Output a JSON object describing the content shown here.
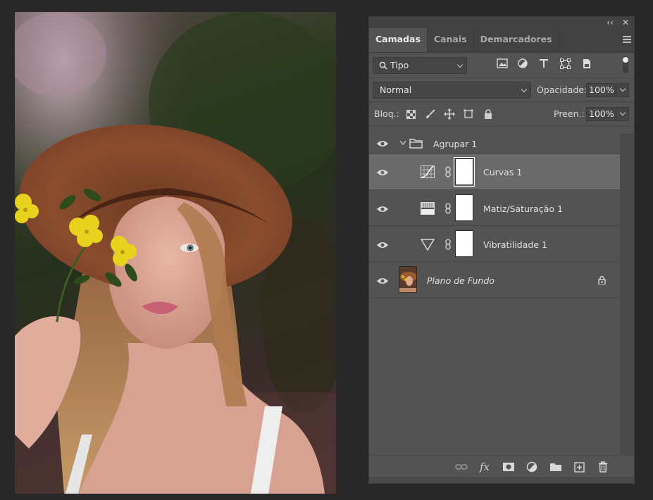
{
  "panel": {
    "collapse_glyph": "‹‹",
    "close_glyph": "✕",
    "tabs": [
      {
        "label": "Camadas"
      },
      {
        "label": "Canais"
      },
      {
        "label": "Demarcadores"
      }
    ],
    "filter": {
      "label": "Tipo",
      "icon": "search-icon"
    },
    "blend_mode": "Normal",
    "opacity_label": "Opacidade:",
    "opacity_value": "100%",
    "lock_label": "Bloq.:",
    "fill_label": "Preen.:",
    "fill_value": "100%"
  },
  "layers": [
    {
      "name": "Agrupar 1",
      "type": "group",
      "icon": "folder-icon",
      "expanded": true,
      "visible": true
    },
    {
      "name": "Curvas 1",
      "type": "adjustment",
      "icon": "curves-icon",
      "selected": true,
      "visible": true
    },
    {
      "name": "Matiz/Saturação 1",
      "type": "adjustment",
      "icon": "hue-saturation-icon",
      "visible": true
    },
    {
      "name": "Vibratilidade 1",
      "type": "adjustment",
      "icon": "vibrance-icon",
      "visible": true
    },
    {
      "name": "Plano de Fundo",
      "type": "background",
      "locked": true,
      "visible": true
    }
  ],
  "bottom_icons": [
    "link-layers-icon",
    "fx-icon",
    "add-mask-icon",
    "adjustment-layer-icon",
    "new-group-icon",
    "new-layer-icon",
    "delete-icon"
  ],
  "bottom_fx_label": "fx",
  "colors": {
    "panel_bg": "#535353",
    "tab_bar_bg": "#424242",
    "selected_layer_bg": "#6a6a6a",
    "app_bg": "#282828"
  }
}
